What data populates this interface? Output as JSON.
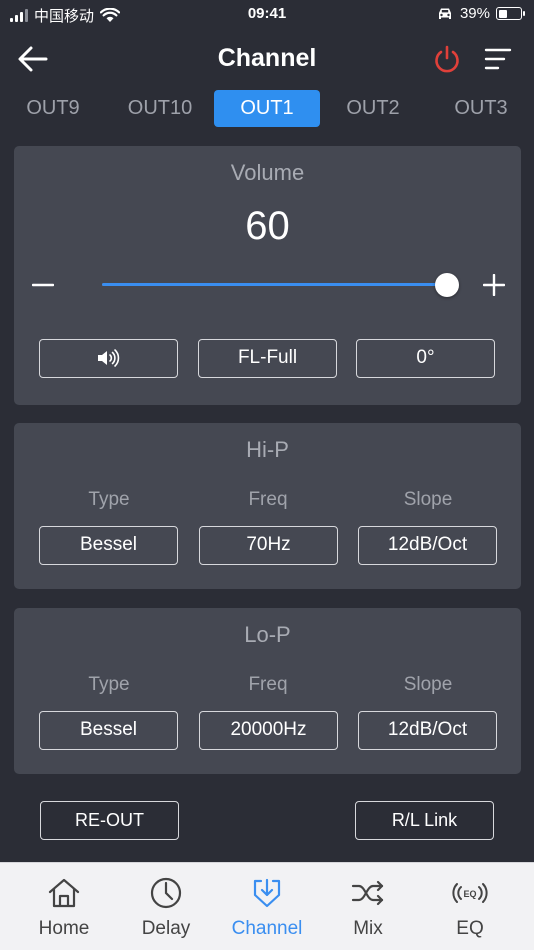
{
  "status_bar": {
    "carrier": "中国移动",
    "time": "09:41",
    "battery": "39%",
    "battery_level": 0.39
  },
  "header": {
    "title": "Channel",
    "power_color": "#e0403a"
  },
  "tabs": [
    {
      "label": "OUT9",
      "active": false
    },
    {
      "label": "OUT10",
      "active": false
    },
    {
      "label": "OUT1",
      "active": true
    },
    {
      "label": "OUT2",
      "active": false
    },
    {
      "label": "OUT3",
      "active": false
    }
  ],
  "volume": {
    "title": "Volume",
    "value": "60",
    "level": 1.0,
    "minus_icon": "minus-icon",
    "plus_icon": "plus-icon",
    "speaker_icon": "speaker-icon",
    "position_label": "FL-Full",
    "phase_label": "0°"
  },
  "hi_pass": {
    "title": "Hi-P",
    "type_label": "Type",
    "freq_label": "Freq",
    "slope_label": "Slope",
    "type_value": "Bessel",
    "freq_value": "70Hz",
    "slope_value": "12dB/Oct"
  },
  "lo_pass": {
    "title": "Lo-P",
    "type_label": "Type",
    "freq_label": "Freq",
    "slope_label": "Slope",
    "type_value": "Bessel",
    "freq_value": "20000Hz",
    "slope_value": "12dB/Oct"
  },
  "actions": {
    "re_out": "RE-OUT",
    "rl_link": "R/L Link"
  },
  "bottom_nav": [
    {
      "label": "Home",
      "icon": "home-icon",
      "active": false
    },
    {
      "label": "Delay",
      "icon": "clock-icon",
      "active": false
    },
    {
      "label": "Channel",
      "icon": "channel-icon",
      "active": true
    },
    {
      "label": "Mix",
      "icon": "shuffle-icon",
      "active": false
    },
    {
      "label": "EQ",
      "icon": "eq-icon",
      "active": false
    }
  ],
  "colors": {
    "accent": "#3a8ef0",
    "background": "#2b2d36",
    "card": "#454852"
  }
}
